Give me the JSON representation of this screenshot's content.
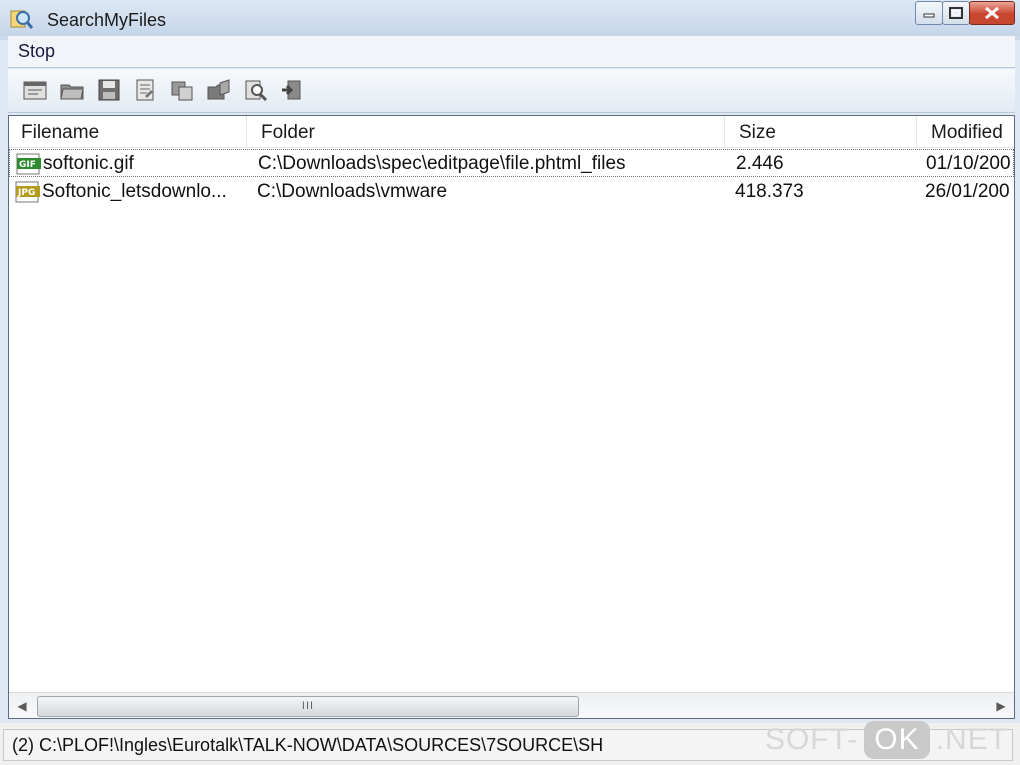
{
  "window": {
    "title": "SearchMyFiles"
  },
  "menu": {
    "items": [
      {
        "label": "Stop"
      }
    ]
  },
  "toolbar": {
    "buttons": [
      {
        "icon": "options-icon"
      },
      {
        "icon": "open-folder-icon"
      },
      {
        "icon": "save-icon"
      },
      {
        "icon": "properties-icon"
      },
      {
        "icon": "copy-icon"
      },
      {
        "icon": "open-file-folder-icon"
      },
      {
        "icon": "find-icon"
      },
      {
        "icon": "exit-icon"
      }
    ]
  },
  "list": {
    "columns": [
      {
        "label": "Filename"
      },
      {
        "label": "Folder"
      },
      {
        "label": "Size"
      },
      {
        "label": "Modified"
      }
    ],
    "rows": [
      {
        "icon": "GIF",
        "filename": "softonic.gif",
        "folder": "C:\\Downloads\\spec\\editpage\\file.phtml_files",
        "size": "2.446",
        "modified": "01/10/200"
      },
      {
        "icon": "JPG",
        "filename": "Softonic_letsdownlo...",
        "folder": "C:\\Downloads\\vmware",
        "size": "418.373",
        "modified": "26/01/200"
      }
    ]
  },
  "scrollbar": {
    "thumb_grip": "III"
  },
  "status": {
    "text": "(2)  C:\\PLOF!\\Ingles\\Eurotalk\\TALK-NOW\\DATA\\SOURCES\\7SOURCE\\SH"
  },
  "watermark": {
    "left": "SOFT-",
    "middle": "OK",
    "right": ".NET"
  },
  "colors": {
    "gif_icon": "#2e8b2e",
    "jpg_icon": "#b49a1e",
    "close_button": "#c7452e"
  }
}
